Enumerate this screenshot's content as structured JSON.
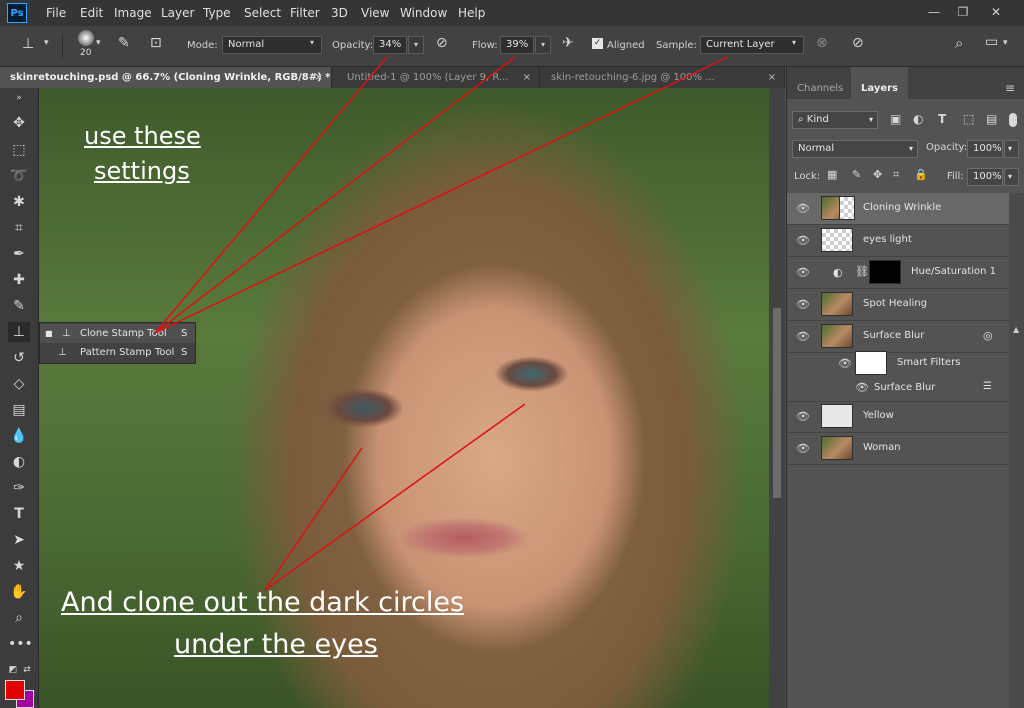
{
  "menu": {
    "logo": "Ps",
    "items": [
      "File",
      "Edit",
      "Image",
      "Layer",
      "Type",
      "Select",
      "Filter",
      "3D",
      "View",
      "Window",
      "Help"
    ]
  },
  "window_controls": {
    "minimize": "—",
    "restore": "❐",
    "close": "✕"
  },
  "options": {
    "brush_size": "20",
    "mode_label": "Mode:",
    "mode_value": "Normal",
    "opacity_label": "Opacity:",
    "opacity_value": "34%",
    "flow_label": "Flow:",
    "flow_value": "39%",
    "aligned_label": "Aligned",
    "sample_label": "Sample:",
    "sample_value": "Current Layer"
  },
  "tabs": [
    {
      "label": "skinretouching.psd @ 66.7% (Cloning Wrinkle, RGB/8#) *",
      "close": "×"
    },
    {
      "label": "Untitled-1 @ 100% (Layer 9, R...",
      "close": "×"
    },
    {
      "label": "skin-retouching-6.jpg @ 100% ...",
      "close": "×"
    }
  ],
  "flyout": {
    "items": [
      {
        "label": "Clone Stamp Tool",
        "key": "S"
      },
      {
        "label": "Pattern Stamp Tool",
        "key": "S"
      }
    ]
  },
  "annotations": {
    "line1": "use these",
    "line2": "settings",
    "bottom1": "And clone out the dark circles",
    "bottom2": "under the eyes"
  },
  "panel": {
    "tab_channels": "Channels",
    "tab_layers": "Layers",
    "kind_label": "Kind",
    "blend_mode": "Normal",
    "opacity_label": "Opacity:",
    "opacity_value": "100%",
    "lock_label": "Lock:",
    "fill_label": "Fill:",
    "fill_value": "100%",
    "layers": [
      {
        "name": "Cloning Wrinkle"
      },
      {
        "name": "eyes light"
      },
      {
        "name": "Hue/Saturation 1"
      },
      {
        "name": "Spot Healing"
      },
      {
        "name": "Surface Blur"
      },
      {
        "name": "Smart Filters"
      },
      {
        "name": "Surface Blur"
      },
      {
        "name": "Yellow"
      },
      {
        "name": "Woman"
      }
    ]
  },
  "colors": {
    "foreground": "#e30000",
    "background": "#a000a0",
    "annotation_line": "#e01010"
  }
}
